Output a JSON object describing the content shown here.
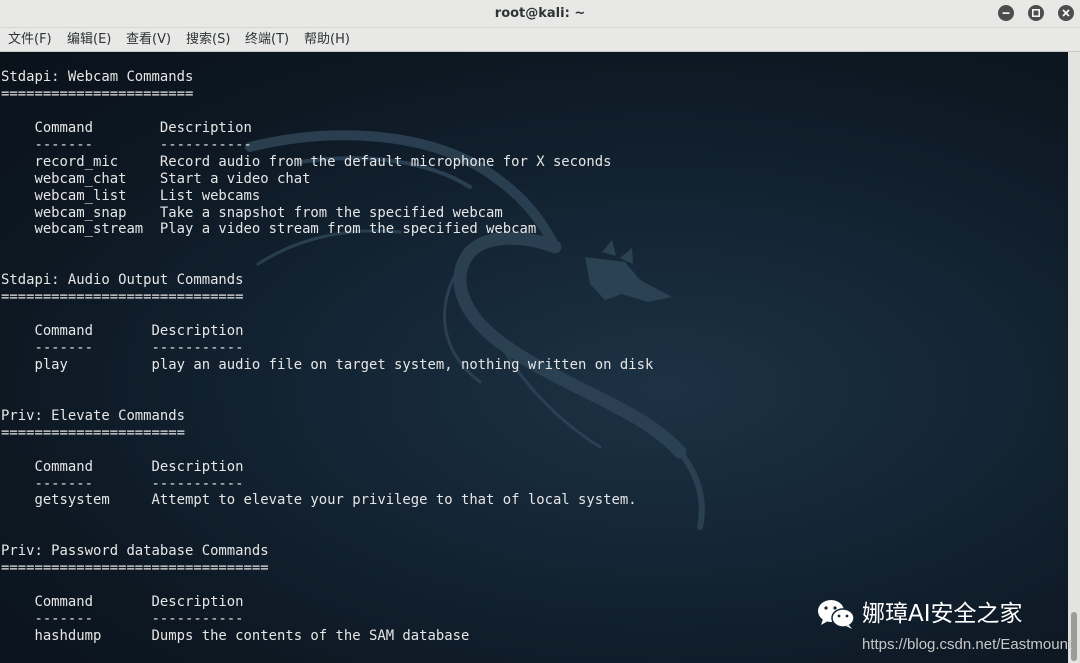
{
  "window": {
    "title": "root@kali: ~",
    "controls": [
      "minimize",
      "maximize",
      "close"
    ]
  },
  "menubar": {
    "items": [
      "文件(F)",
      "编辑(E)",
      "查看(V)",
      "搜索(S)",
      "终端(T)",
      "帮助(H)"
    ]
  },
  "terminal": {
    "lines": [
      "Stdapi: Webcam Commands",
      "=======================",
      "",
      "    Command        Description",
      "    -------        -----------",
      "    record_mic     Record audio from the default microphone for X seconds",
      "    webcam_chat    Start a video chat",
      "    webcam_list    List webcams",
      "    webcam_snap    Take a snapshot from the specified webcam",
      "    webcam_stream  Play a video stream from the specified webcam",
      "",
      "",
      "Stdapi: Audio Output Commands",
      "=============================",
      "",
      "    Command       Description",
      "    -------       -----------",
      "    play          play an audio file on target system, nothing written on disk",
      "",
      "",
      "Priv: Elevate Commands",
      "======================",
      "",
      "    Command       Description",
      "    -------       -----------",
      "    getsystem     Attempt to elevate your privilege to that of local system.",
      "",
      "",
      "Priv: Password database Commands",
      "================================",
      "",
      "    Command       Description",
      "    -------       -----------",
      "    hashdump      Dumps the contents of the SAM database"
    ]
  },
  "watermark": {
    "icon": "wechat-icon",
    "text": "娜璋AI安全之家",
    "url": "https://blog.csdn.net/Eastmount"
  },
  "colors": {
    "titlebar_bg": "#e8e8e7",
    "terminal_bg": "#0d1823",
    "terminal_fg": "#e6e6e6"
  }
}
